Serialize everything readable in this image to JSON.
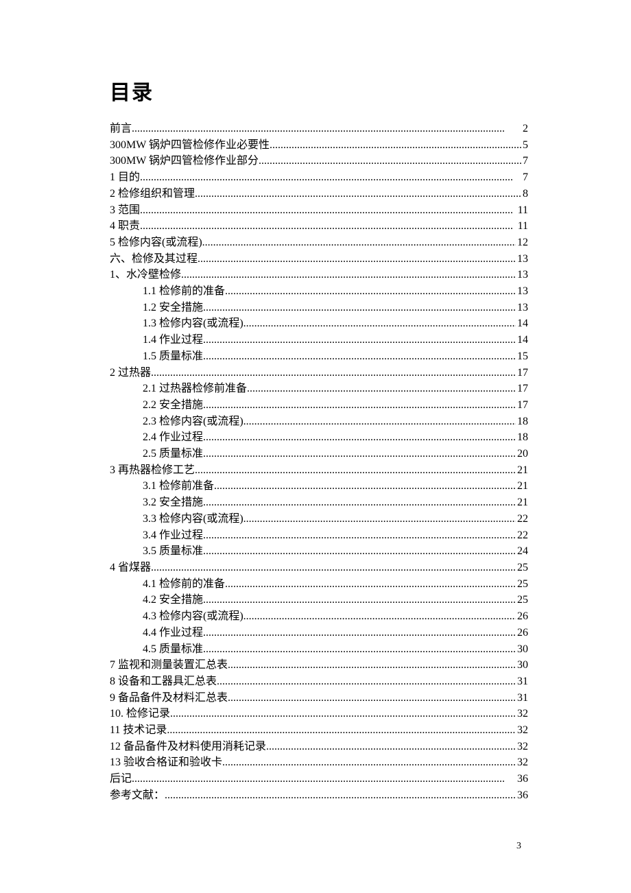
{
  "title": "目录",
  "page_number": "3",
  "entries": [
    {
      "label": "前言",
      "page": "2",
      "indent": 0
    },
    {
      "label": "300MW 锅炉四管检修作业必要性",
      "page": "5",
      "indent": 0
    },
    {
      "label": "300MW 锅炉四管检修作业部分",
      "page": "7",
      "indent": 0
    },
    {
      "label": "1 目的",
      "page": "7",
      "indent": 0
    },
    {
      "label": "2 检修组织和管理",
      "page": "8",
      "indent": 0
    },
    {
      "label": "3  范围",
      "page": "11",
      "indent": 0
    },
    {
      "label": "4 职责",
      "page": "11",
      "indent": 0
    },
    {
      "label": "5 检修内容(或流程)",
      "page": "12",
      "indent": 0
    },
    {
      "label": "六、检修及其过程",
      "page": "13",
      "indent": 0
    },
    {
      "label": "1、水冷壁检修",
      "page": "13",
      "indent": 0
    },
    {
      "label": "1.1 检修前的准备",
      "page": "13",
      "indent": 1
    },
    {
      "label": "1.2 安全措施",
      "page": "13",
      "indent": 1
    },
    {
      "label": "1.3 检修内容(或流程)",
      "page": "14",
      "indent": 1
    },
    {
      "label": "1.4 作业过程",
      "page": "14",
      "indent": 1
    },
    {
      "label": "1.5 质量标准",
      "page": "15",
      "indent": 1
    },
    {
      "label": "2 过热器",
      "page": "17",
      "indent": 0
    },
    {
      "label": "2.1 过热器检修前准备",
      "page": "17",
      "indent": 1
    },
    {
      "label": "2.2 安全措施",
      "page": "17",
      "indent": 1
    },
    {
      "label": "2.3 检修内容(或流程)",
      "page": "18",
      "indent": 1
    },
    {
      "label": "2.4 作业过程",
      "page": "18",
      "indent": 1
    },
    {
      "label": "2.5  质量标准",
      "page": "20",
      "indent": 1
    },
    {
      "label": "3 再热器检修工艺",
      "page": "21",
      "indent": 0
    },
    {
      "label": "3.1 检修前准备",
      "page": "21",
      "indent": 1
    },
    {
      "label": "3.2 安全措施",
      "page": "21",
      "indent": 1
    },
    {
      "label": "3.3 检修内容(或流程)",
      "page": "22",
      "indent": 1
    },
    {
      "label": "3.4 作业过程",
      "page": "22",
      "indent": 1
    },
    {
      "label": "3.5 质量标准",
      "page": "24",
      "indent": 1
    },
    {
      "label": "4 省煤器",
      "page": "25",
      "indent": 0
    },
    {
      "label": "4.1 检修前的准备",
      "page": "25",
      "indent": 1
    },
    {
      "label": "4.2 安全措施",
      "page": "25",
      "indent": 1
    },
    {
      "label": "4.3 检修内容(或流程)",
      "page": "26",
      "indent": 1
    },
    {
      "label": "4.4 作业过程",
      "page": "26",
      "indent": 1
    },
    {
      "label": "4.5 质量标准",
      "page": "30",
      "indent": 1
    },
    {
      "label": "7 监视和测量装置汇总表",
      "page": "30",
      "indent": 0
    },
    {
      "label": "8   设备和工器具汇总表",
      "page": "31",
      "indent": 0
    },
    {
      "label": "9 备品备件及材料汇总表",
      "page": "31",
      "indent": 0
    },
    {
      "label": "10. 检修记录",
      "page": "32",
      "indent": 0
    },
    {
      "label": "11 技术记录",
      "page": "32",
      "indent": 0
    },
    {
      "label": "12 备品备件及材料使用消耗记录",
      "page": "32",
      "indent": 0
    },
    {
      "label": "13 验收合格证和验收卡",
      "page": "32",
      "indent": 0
    },
    {
      "label": "后记",
      "page": "36",
      "indent": 0
    },
    {
      "label": "参考文献：",
      "page": "36",
      "indent": 0
    }
  ]
}
